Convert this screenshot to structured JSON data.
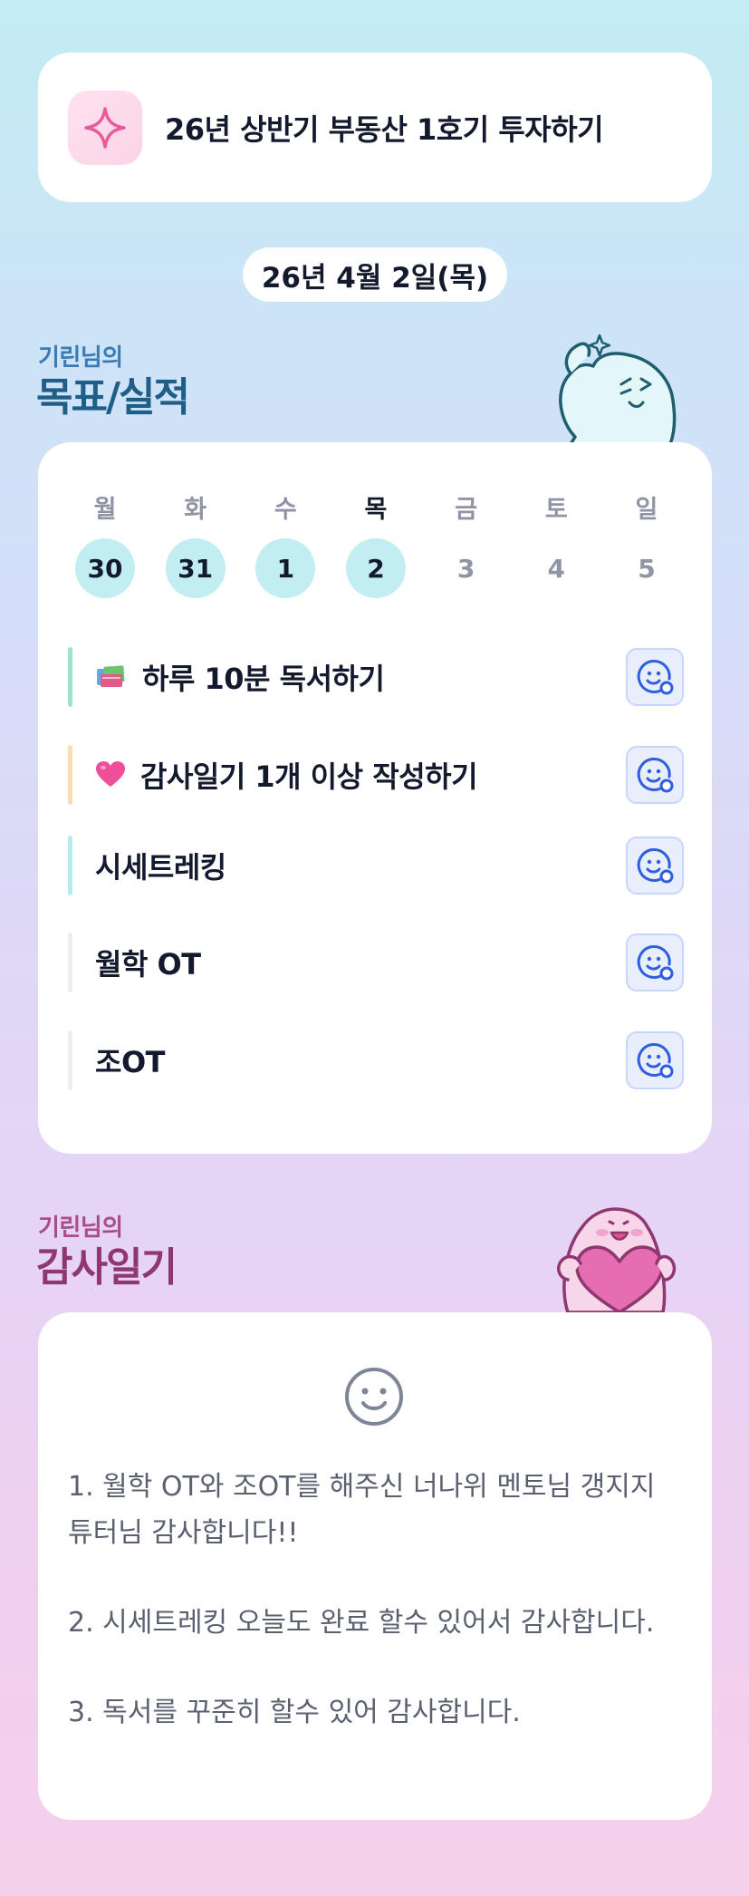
{
  "goal_banner": {
    "icon": "sparkle-icon",
    "text": "26년 상반기 부동산 1호기 투자하기"
  },
  "date": "26년 4월 2일(목)",
  "goals_section": {
    "title_small": "기린님의",
    "title_big": "목표/실적"
  },
  "week": {
    "days": [
      "월",
      "화",
      "수",
      "목",
      "금",
      "토",
      "일"
    ],
    "dates": [
      "30",
      "31",
      "1",
      "2",
      "3",
      "4",
      "5"
    ],
    "completed": [
      true,
      true,
      true,
      true,
      false,
      false,
      false
    ],
    "today_index": 3
  },
  "tasks": [
    {
      "emoji": "books-icon",
      "label": "하루 10분 독서하기",
      "bar_color": "#9be4cc"
    },
    {
      "emoji": "heart-icon",
      "label": "감사일기 1개 이상 작성하기",
      "bar_color": "#ffdcb0"
    },
    {
      "emoji": "",
      "label": "시세트레킹",
      "bar_color": "#b3ecf1"
    },
    {
      "emoji": "",
      "label": "월학 OT",
      "bar_color": "#eeeeee"
    },
    {
      "emoji": "",
      "label": "조OT",
      "bar_color": "#eeeeee"
    }
  ],
  "diary_section": {
    "title_small": "기린님의",
    "title_big": "감사일기"
  },
  "diary": {
    "mood_icon": "smile-icon",
    "entries": [
      "1. 월학 OT와 조OT를 해주신 너나위 멘토님 갱지지 튜터님 감사합니다!!",
      "2. 시세트레킹 오늘도 완료 할수 있어서 감사합니다.",
      "3. 독서를 꾸준히 할수 있어 감사합니다."
    ]
  }
}
